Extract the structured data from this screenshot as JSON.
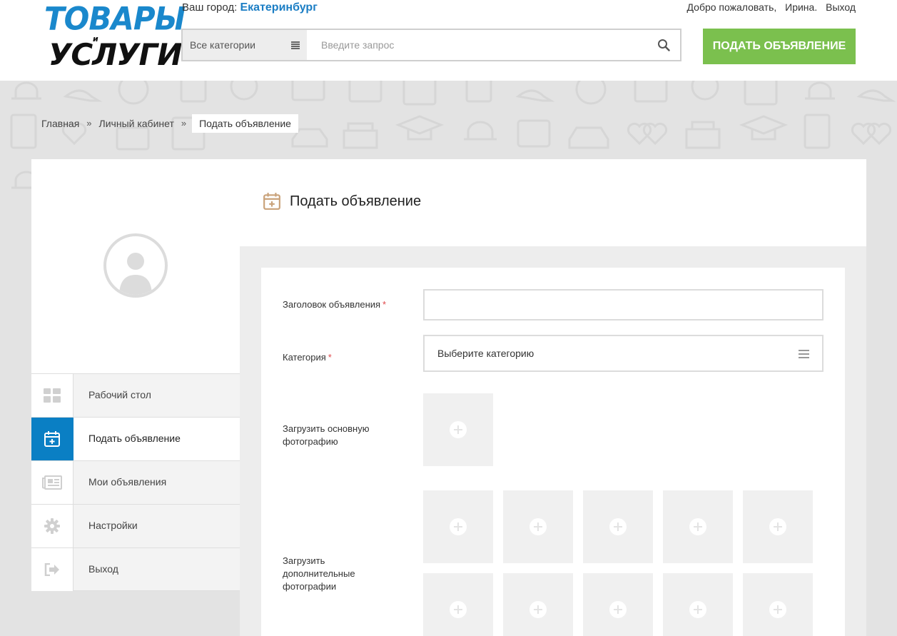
{
  "header": {
    "logo_line1": "ТОВАРЫ",
    "logo_line2": "и",
    "logo_line3": "УСЛУГИ",
    "city_label": "Ваш город:",
    "city_name": "Екатеринбург",
    "welcome": "Добро пожаловать,",
    "user_name": "Ирина.",
    "logout": "Выход",
    "search_category": "Все категории",
    "search_placeholder": "Введите запрос",
    "post_button": "ПОДАТЬ ОБЪЯВЛЕНИЕ"
  },
  "breadcrumbs": {
    "home": "Главная",
    "account": "Личный кабинет",
    "current": "Подать объявление",
    "separator": "»"
  },
  "sidebar": {
    "items": [
      {
        "label": "Рабочий стол",
        "icon": "dashboard-icon",
        "active": false
      },
      {
        "label": "Подать объявление",
        "icon": "calendar-plus-icon",
        "active": true
      },
      {
        "label": "Мои объявления",
        "icon": "newspaper-icon",
        "active": false
      },
      {
        "label": "Настройки",
        "icon": "gear-icon",
        "active": false
      },
      {
        "label": "Выход",
        "icon": "logout-icon",
        "active": false
      }
    ]
  },
  "main": {
    "title": "Подать объявление",
    "form": {
      "title_label": "Заголовок объявления",
      "title_value": "",
      "category_label": "Категория",
      "category_value": "Выберите категорию",
      "main_photo_label": "Загрузить основную фотографию",
      "extra_photos_label": "Загрузить дополнительные фотографии",
      "required_mark": "*"
    }
  },
  "colors": {
    "accent_blue": "#0a7fc4",
    "city_blue": "#1a7dc4",
    "post_green": "#7bc04e",
    "required_red": "#e0484a",
    "title_icon": "#c9a27a"
  }
}
